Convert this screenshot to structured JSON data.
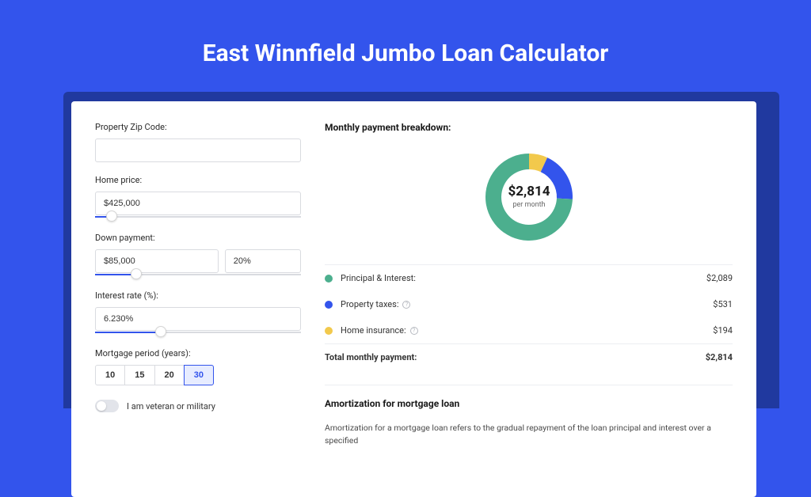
{
  "title": "East Winnfield Jumbo Loan Calculator",
  "form": {
    "zip": {
      "label": "Property Zip Code:",
      "value": ""
    },
    "price": {
      "label": "Home price:",
      "value": "$425,000",
      "slider_pct": 8
    },
    "down": {
      "label": "Down payment:",
      "amount": "$85,000",
      "pct": "20%",
      "slider_pct": 20
    },
    "rate": {
      "label": "Interest rate (%):",
      "value": "6.230%",
      "slider_pct": 32
    },
    "period": {
      "label": "Mortgage period (years):",
      "options": [
        "10",
        "15",
        "20",
        "30"
      ],
      "active": "30"
    },
    "veteran": {
      "label": "I am veteran or military",
      "on": false
    }
  },
  "breakdown": {
    "title": "Monthly payment breakdown:",
    "center_value": "$2,814",
    "center_sub": "per month",
    "items": [
      {
        "color": "#4caf8e",
        "label": "Principal & Interest:",
        "value": "$2,089",
        "info": false
      },
      {
        "color": "#3354ec",
        "label": "Property taxes:",
        "value": "$531",
        "info": true
      },
      {
        "color": "#f2c94c",
        "label": "Home insurance:",
        "value": "$194",
        "info": true
      }
    ],
    "total_label": "Total monthly payment:",
    "total_value": "$2,814"
  },
  "amort": {
    "title": "Amortization for mortgage loan",
    "text": "Amortization for a mortgage loan refers to the gradual repayment of the loan principal and interest over a specified"
  },
  "chart_data": {
    "type": "pie",
    "title": "Monthly payment breakdown",
    "series": [
      {
        "name": "Principal & Interest",
        "value": 2089,
        "color": "#4caf8e"
      },
      {
        "name": "Property taxes",
        "value": 531,
        "color": "#3354ec"
      },
      {
        "name": "Home insurance",
        "value": 194,
        "color": "#f2c94c"
      }
    ],
    "total": 2814
  }
}
